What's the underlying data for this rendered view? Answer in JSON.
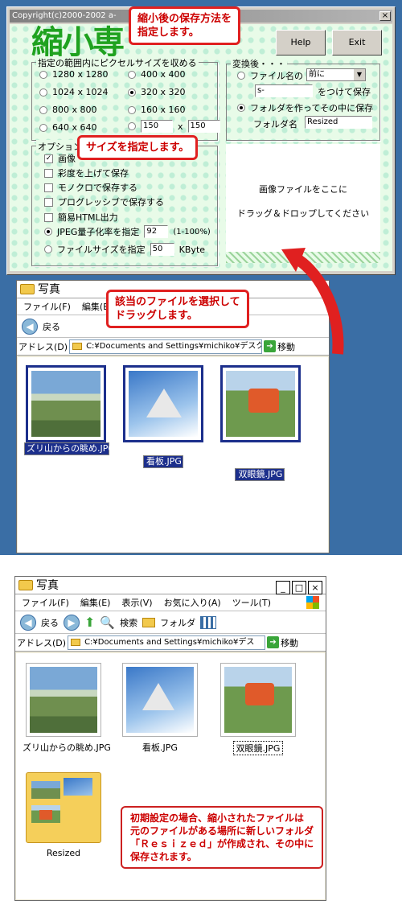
{
  "app": {
    "title": "Copyright(c)2000-2002 a-",
    "logo": "縮小専",
    "help": "Help",
    "exit": "Exit",
    "range_group": "指定の範囲内にピクセルサイズを収める",
    "sizes": [
      "1280 x 1280",
      "400 x 400",
      "1024 x 1024",
      "320 x 320",
      "800 x 800",
      "160 x 160",
      "640 x 640"
    ],
    "custom_w": "150",
    "custom_x": "x",
    "custom_h": "150",
    "options_group": "オプション",
    "opt_image": "画像",
    "opt_saturation": "彩度を上げて保存",
    "opt_mono": "モノクロで保存する",
    "opt_progressive": "プログレッシブで保存する",
    "opt_html": "簡易HTML出力",
    "opt_jpeg": "JPEG量子化率を指定",
    "jpeg_val": "92",
    "jpeg_unit": "(1-100%)",
    "opt_filesize": "ファイルサイズを指定",
    "filesize_val": "50",
    "filesize_unit": "KByte",
    "convert_group": "変換後・・・",
    "fn_label": "ファイル名の",
    "fn_select": "前に",
    "fn_prefix": "s-",
    "fn_suffix": "をつけて保存",
    "folder_radio": "フォルダを作ってその中に保存",
    "folder_label": "フォルダ名",
    "folder_name": "Resized",
    "drop1": "画像ファイルをここに",
    "drop2": "ドラッグ＆ドロップしてください"
  },
  "callouts": {
    "save_method": "縮小後の保存方法を\n指定します。",
    "size": "サイズを指定します。",
    "drag": "該当のファイルを選択して\nドラッグします。",
    "result": "初期設定の場合、縮小されたファイルは\n元のファイルがある場所に新しいフォルダ\n「Ｒｅｓｉｚｅｄ」が作成され、その中に\n保存されます。"
  },
  "explorer1": {
    "title": "写真",
    "menu": [
      "ファイル(F)",
      "編集(E)"
    ],
    "back": "戻る",
    "address_label": "アドレス(D)",
    "address": "C:¥Documents and Settings¥michiko¥デスク",
    "go": "移動",
    "files": [
      "ズリ山からの眺め.JPG",
      "看板.JPG",
      "双眼鏡.JPG"
    ]
  },
  "explorer2": {
    "title": "写真",
    "menu": [
      "ファイル(F)",
      "編集(E)",
      "表示(V)",
      "お気に入り(A)",
      "ツール(T)"
    ],
    "back": "戻る",
    "search": "検索",
    "folder": "フォルダ",
    "address_label": "アドレス(D)",
    "address": "C:¥Documents and Settings¥michiko¥デス",
    "go": "移動",
    "files": [
      "ズリ山からの眺め.JPG",
      "看板.JPG",
      "双眼鏡.JPG"
    ],
    "folder_item": "Resized"
  },
  "colors": {
    "accent_red": "#e02020",
    "select_blue": "#1c2f8c",
    "logo_green": "#1fa21f",
    "desktop": "#3a6ea5"
  }
}
